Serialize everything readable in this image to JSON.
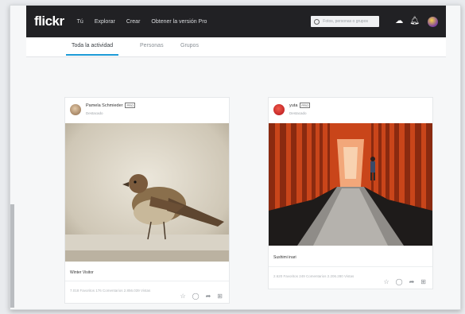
{
  "nav": {
    "logo": "flickr",
    "links": [
      "Tú",
      "Explorar",
      "Crear",
      "Obtener la versión Pro"
    ],
    "search_placeholder": "Fotos, personas o grupos"
  },
  "tabs": [
    "Toda la actividad",
    "Personas",
    "Grupos"
  ],
  "cards": [
    {
      "author": "Pamela Schmieder",
      "badge": "PRO",
      "subtitle": "Destacado",
      "title": "Winter Visitor",
      "stats": "7.018 Favoritos   176 Comentarios   2.856.039 Vistas"
    },
    {
      "author": "yuta",
      "badge": "PRO",
      "subtitle": "Destacado",
      "title": "Sushimi inari",
      "stats": "2.620 Favoritos   249 Comentarios   2.206.280 Vistas"
    }
  ],
  "icons": [
    "search-icon",
    "upload-icon",
    "notification-icon",
    "star-icon",
    "comment-icon",
    "share-icon",
    "add-to-gallery-icon"
  ],
  "colors": {
    "nav_bg": "#212124",
    "tab_accent": "#1e9bd7",
    "torii": "#d24a1a"
  }
}
